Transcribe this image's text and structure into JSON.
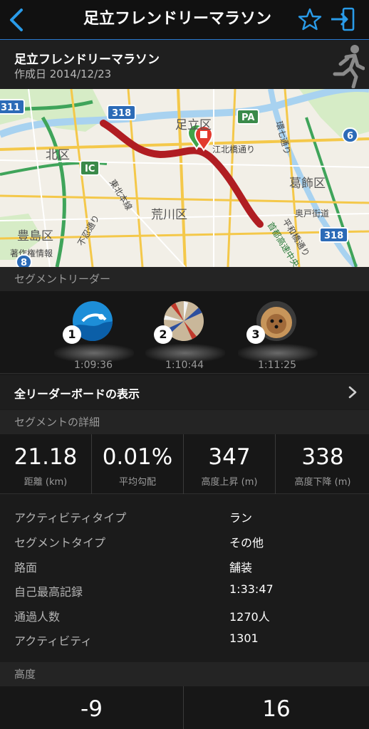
{
  "nav": {
    "title": "足立フレンドリーマラソン",
    "back_icon": "chevron-left-icon",
    "favorite_icon": "star-outline-icon",
    "share_icon": "share-arrow-icon"
  },
  "segment": {
    "name": "足立フレンドリーマラソン",
    "created": "作成日 2014/12/23",
    "activity_icon": "runner-icon"
  },
  "map": {
    "labels": {
      "adachi": "足立区",
      "kita": "北区",
      "katsushika": "葛飾区",
      "arakawa": "荒川区",
      "toshima": "豊島区",
      "koboku": "江北橋通り",
      "fushinobu": "不忍通り",
      "hirawa": "平和橋通り",
      "shuto": "首都高速中央",
      "tohoku": "東北本線",
      "kanshichi": "環七通り",
      "okudo": "奥戸街道",
      "info": "著作権情報"
    },
    "shields": {
      "r318a": "318",
      "r318b": "318",
      "r6": "6",
      "r311": "311",
      "ic": "IC",
      "pa": "PA",
      "r8": "8"
    },
    "route_color": "#b01d22"
  },
  "leaders_section": {
    "title": "セグメントリーダー",
    "leaders": [
      {
        "rank": "1",
        "time": "1:09:36"
      },
      {
        "rank": "2",
        "time": "1:10:44"
      },
      {
        "rank": "3",
        "time": "1:11:25"
      }
    ],
    "view_all": "全リーダーボードの表示"
  },
  "details_section": {
    "title": "セグメントの詳細",
    "stats": [
      {
        "value": "21.18",
        "label": "距離 (km)"
      },
      {
        "value": "0.01%",
        "label": "平均勾配"
      },
      {
        "value": "347",
        "label": "高度上昇 (m)"
      },
      {
        "value": "338",
        "label": "高度下降 (m)"
      }
    ],
    "rows": [
      {
        "key": "アクティビティタイプ",
        "value": "ラン"
      },
      {
        "key": "セグメントタイプ",
        "value": "その他"
      },
      {
        "key": "路面",
        "value": "舗装"
      },
      {
        "key": "自己最高記録",
        "value": "1:33:47"
      },
      {
        "key": "通過人数",
        "value": "1270人"
      },
      {
        "key": "アクティビティ",
        "value": "1301"
      }
    ]
  },
  "elevation_section": {
    "title": "高度",
    "values": [
      "-9",
      "16"
    ]
  },
  "colors": {
    "accent": "#2a7bd0",
    "background": "#1b1b1b"
  }
}
